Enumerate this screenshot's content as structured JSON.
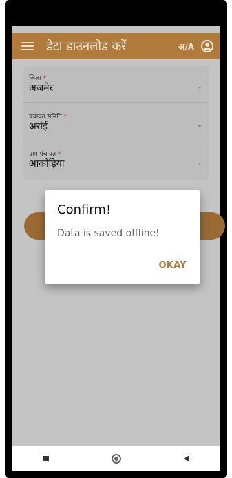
{
  "app_bar": {
    "title": "डेटा डाउनलोड करें",
    "lang_toggle": "अ/A",
    "icons": [
      "menu-icon",
      "account-icon"
    ]
  },
  "form": {
    "fields": [
      {
        "label": "जिला",
        "required_mark": "*",
        "value": "अजमेर"
      },
      {
        "label": "पंचायत समिति",
        "required_mark": "*",
        "value": "अरांई"
      },
      {
        "label": "ग्राम पंचायत",
        "required_mark": "*",
        "value": "आकोड़िया"
      }
    ]
  },
  "dialog": {
    "title": "Confirm!",
    "message": "Data is saved offline!",
    "ok_label": "OKAY"
  },
  "colors": {
    "brand": "#b07a3a",
    "scrim": "#c4c4c4"
  }
}
